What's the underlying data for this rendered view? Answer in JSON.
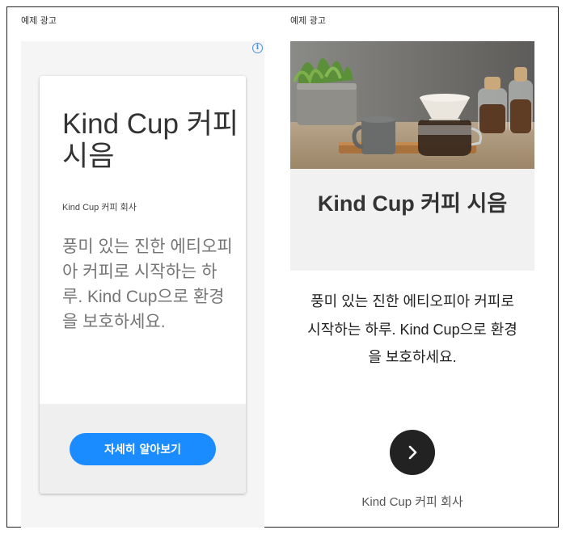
{
  "left_ad": {
    "label": "예제 광고",
    "title": "Kind Cup 커피 시음",
    "advertiser": "Kind Cup 커피 회사",
    "body": "풍미 있는 진한 에티오피아 커피로 시작하는 하루. Kind Cup으로 환경을 보호하세요.",
    "cta_label": "자세히 알아보기",
    "info_icon": "i"
  },
  "right_ad": {
    "label": "예제 광고",
    "title": "Kind Cup 커피 시음",
    "body": "풍미 있는 진한 에티오피아 커피로 시작하는 하루. Kind Cup으로 환경을 보호하세요.",
    "advertiser": "Kind Cup 커피 회사",
    "arrow_icon": "chevron-right-icon"
  },
  "colors": {
    "cta": "#1a8cff",
    "arrow_button": "#222222"
  }
}
